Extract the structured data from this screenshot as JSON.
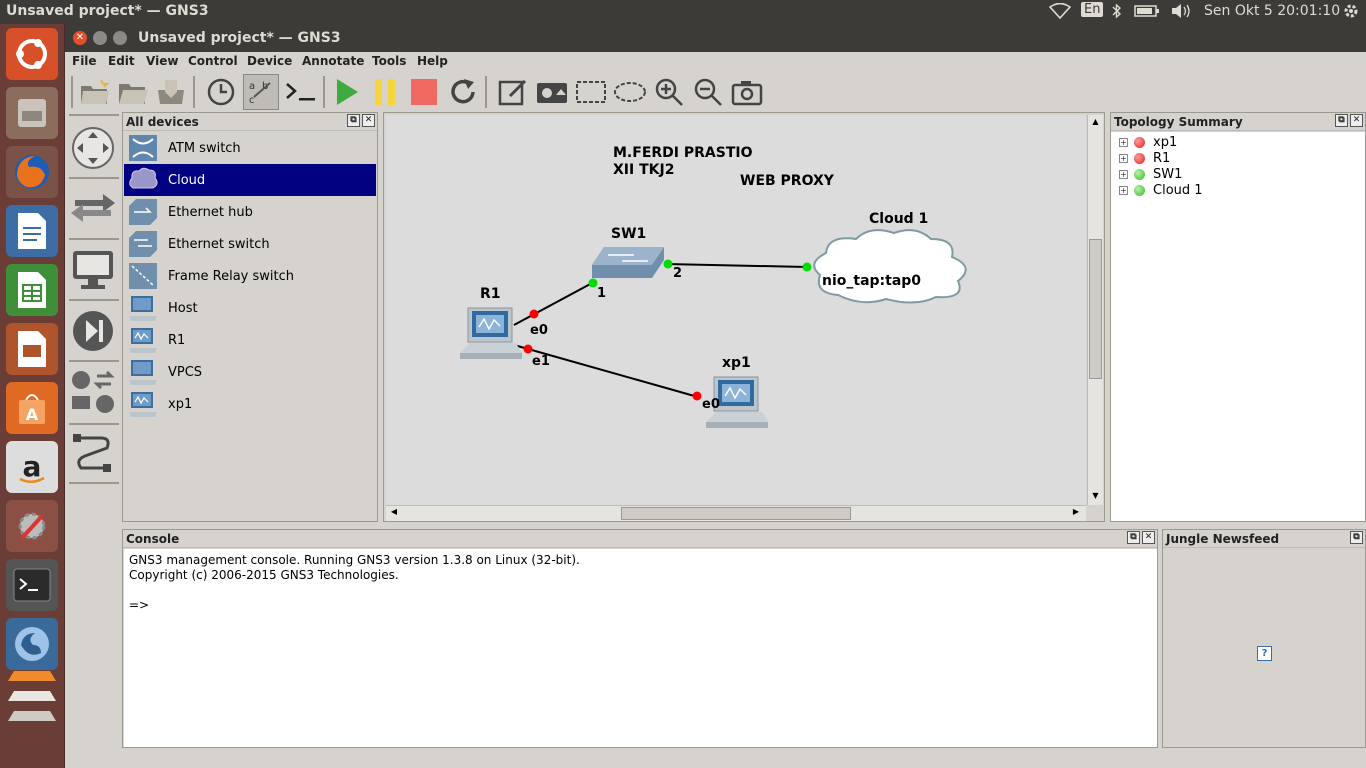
{
  "system": {
    "title": "Unsaved project* — GNS3",
    "keyboard": "En",
    "datetime": "Sen Okt  5 20:01:10"
  },
  "window": {
    "title": "Unsaved project* — GNS3"
  },
  "menu": [
    "File",
    "Edit",
    "View",
    "Control",
    "Device",
    "Annotate",
    "Tools",
    "Help"
  ],
  "devices_panel": {
    "title": "All devices",
    "items": [
      {
        "label": "ATM switch",
        "icon": "atm-switch-icon"
      },
      {
        "label": "Cloud",
        "icon": "cloud-icon",
        "selected": true
      },
      {
        "label": "Ethernet hub",
        "icon": "ethernet-hub-icon"
      },
      {
        "label": "Ethernet switch",
        "icon": "ethernet-switch-icon"
      },
      {
        "label": "Frame Relay switch",
        "icon": "frame-relay-switch-icon"
      },
      {
        "label": "Host",
        "icon": "host-icon"
      },
      {
        "label": "R1",
        "icon": "qemu-vm-icon"
      },
      {
        "label": "VPCS",
        "icon": "vpcs-icon"
      },
      {
        "label": "xp1",
        "icon": "qemu-vm-icon"
      }
    ]
  },
  "canvas": {
    "notes": {
      "author": "M.FERDI PRASTIO",
      "class": "XII TKJ2",
      "topic": "WEB PROXY"
    },
    "nodes": {
      "sw1": {
        "name": "SW1"
      },
      "cloud": {
        "name": "Cloud 1",
        "iface": "nio_tap:tap0"
      },
      "r1": {
        "name": "R1"
      },
      "xp1": {
        "name": "xp1"
      }
    },
    "ports": {
      "r1_e0": "e0",
      "r1_e1": "e1",
      "sw1_p1": "1",
      "sw1_p2": "2",
      "xp1_e0": "e0"
    },
    "colors": {
      "link_up": "#00dd00",
      "link_down": "#ff0000"
    }
  },
  "topology": {
    "title": "Topology Summary",
    "items": [
      {
        "label": "xp1",
        "status": "stopped"
      },
      {
        "label": "R1",
        "status": "stopped"
      },
      {
        "label": "SW1",
        "status": "started"
      },
      {
        "label": "Cloud 1",
        "status": "started"
      }
    ]
  },
  "console": {
    "title": "Console",
    "line1": "GNS3 management console. Running GNS3 version 1.3.8 on Linux (32-bit).",
    "line2": "Copyright (c) 2006-2015 GNS3 Technologies.",
    "prompt": "=>"
  },
  "newsfeed": {
    "title": "Jungle Newsfeed"
  }
}
